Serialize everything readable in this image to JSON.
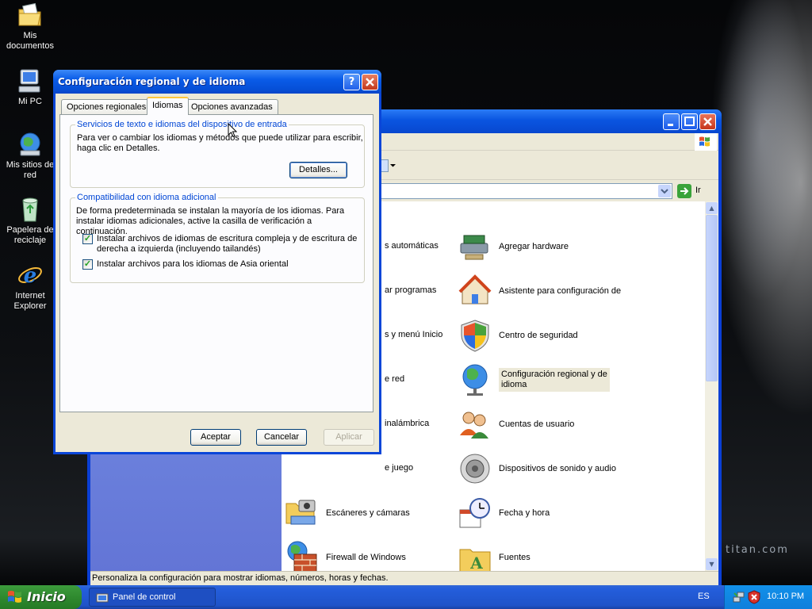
{
  "desktop": {
    "icons": [
      {
        "label_1": "Mis",
        "label_2": "documentos",
        "icon": "my-documents-icon"
      },
      {
        "label_1": "Mi PC",
        "icon": "my-computer-icon"
      },
      {
        "label_1": "Mis sitios de",
        "label_2": "red",
        "icon": "network-places-icon"
      },
      {
        "label_1": "Papelera de",
        "label_2": "reciclaje",
        "icon": "recycle-bin-icon"
      },
      {
        "label_1": "Internet",
        "label_2": "Explorer",
        "icon": "internet-explorer-icon"
      }
    ],
    "watermark": "titan.com"
  },
  "control_panel": {
    "address_go_label": "Ir",
    "status_text": "Personaliza la configuración para mostrar idiomas, números, horas y fechas.",
    "partial_items": [
      "s automáticas",
      "ar programas",
      "s y menú Inicio",
      "e red",
      "inalámbrica",
      "e juego"
    ],
    "items": [
      {
        "label": "Agregar hardware",
        "icon": "add-hardware-icon"
      },
      {
        "label": "Asistente para configuración de",
        "icon": "network-setup-icon"
      },
      {
        "label": "Centro de seguridad",
        "icon": "security-center-icon"
      },
      {
        "label_1": "Configuración regional y de",
        "label_2": "idioma",
        "icon": "regional-settings-icon",
        "selected": true
      },
      {
        "label": "Cuentas de usuario",
        "icon": "user-accounts-icon"
      },
      {
        "label": "Dispositivos de sonido y audio",
        "icon": "sound-icon"
      },
      {
        "label": "Escáneres y cámaras",
        "icon": "scanners-icon"
      },
      {
        "label": "Fecha y hora",
        "icon": "date-time-icon"
      },
      {
        "label": "Firewall de Windows",
        "icon": "firewall-icon"
      },
      {
        "label": "Fuentes",
        "icon": "fonts-icon"
      }
    ]
  },
  "dialog": {
    "title": "Configuración regional y de idioma",
    "tabs": [
      "Opciones regionales",
      "Idiomas",
      "Opciones avanzadas"
    ],
    "active_tab": "Idiomas",
    "group1": {
      "title": "Servicios de texto e idiomas del dispositivo de entrada",
      "line_1": "Para ver o cambiar los idiomas y métodos que puede utilizar para escribir,",
      "line_2": "haga clic en Detalles.",
      "details_button": "Detalles..."
    },
    "group2": {
      "title": "Compatibilidad con idioma adicional",
      "line_1": "De forma predeterminada se instalan la mayoría de los idiomas. Para",
      "line_2": "instalar idiomas adicionales, active la casilla de verificación a continuación.",
      "checkbox1_line_1": "Instalar archivos de idiomas de escritura compleja y de escritura de",
      "checkbox1_line_2": "derecha a izquierda (incluyendo tailandés)",
      "checkbox1_checked": true,
      "checkbox2": "Instalar archivos para los idiomas de Asia oriental",
      "checkbox2_checked": true
    },
    "buttons": {
      "ok": "Aceptar",
      "cancel": "Cancelar",
      "apply": "Aplicar"
    }
  },
  "taskbar": {
    "start_label": "Inicio",
    "task_label": "Panel de control",
    "language": "ES",
    "clock": "10:10 PM"
  },
  "colors": {
    "titlebar_blue": "#0a5ce8",
    "start_green": "#2f8a2f",
    "group_title_blue": "#0046d5",
    "dialog_face": "#ece9d8"
  }
}
